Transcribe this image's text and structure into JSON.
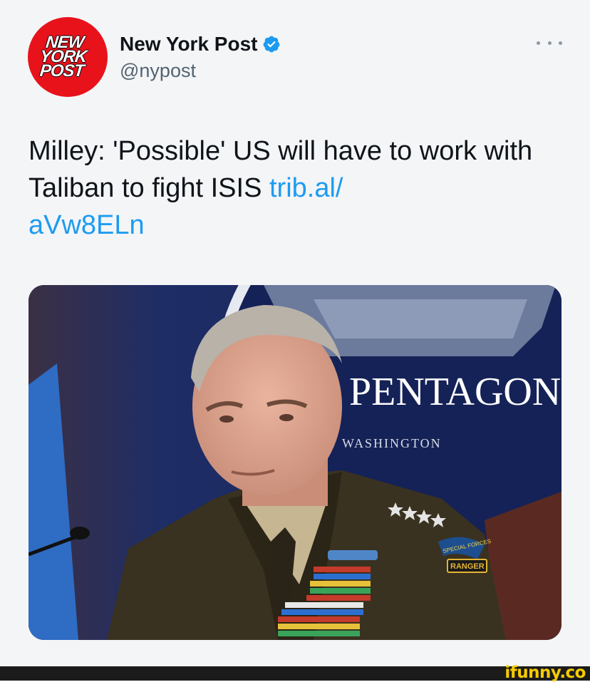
{
  "account": {
    "display_name": "New York Post",
    "handle": "@nypost",
    "verified": true,
    "avatar_logo_lines": [
      "NEW",
      "YORK",
      "POST"
    ],
    "avatar_color": "#e8121b",
    "verified_icon": "verified-badge-icon",
    "more_icon": "more-options-icon"
  },
  "tweet": {
    "text": "Milley: 'Possible' US will have to work with Taliban to fight ISIS ",
    "link_text": "trib.al/\naVw8ELn",
    "link_color": "#1d9bf0"
  },
  "media": {
    "sign_text": "PENTAGON",
    "sign_subtext": "WASHINGTON",
    "patch_top": "SPECIAL FORCES",
    "patch_bottom": "RANGER"
  },
  "watermark": {
    "text": "ifunny.co",
    "color": "#f5cc00"
  }
}
